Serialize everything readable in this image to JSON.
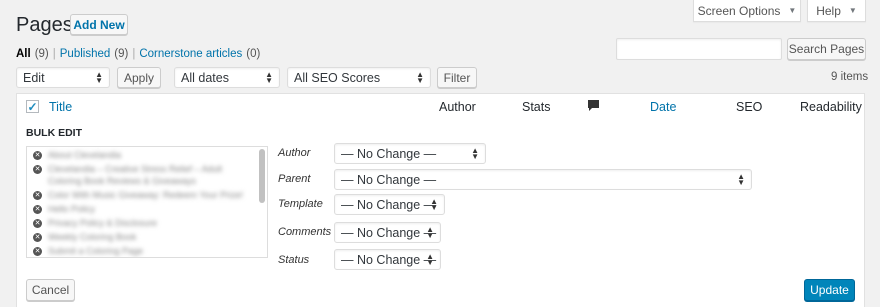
{
  "header": {
    "title": "Pages",
    "add_new": "Add New"
  },
  "screen_tabs": {
    "screen_options": "Screen Options",
    "help": "Help"
  },
  "filters": {
    "all": "All",
    "all_count": "(9)",
    "sep1": "|",
    "published": "Published",
    "published_count": "(9)",
    "sep2": "|",
    "cornerstone": "Cornerstone articles",
    "cornerstone_count": "(0)"
  },
  "search": {
    "placeholder": "",
    "button": "Search Pages"
  },
  "bulk_bar": {
    "action_value": "Edit",
    "apply": "Apply",
    "dates_value": "All dates",
    "seo_value": "All SEO Scores",
    "filter": "Filter",
    "items_count": "9 items"
  },
  "columns": {
    "title": "Title",
    "author": "Author",
    "stats": "Stats",
    "date": "Date",
    "seo": "SEO",
    "readability": "Readability"
  },
  "bulk_edit": {
    "heading": "BULK EDIT",
    "titles": [
      "About Clevelandia",
      "Clevelandia – Creative Stress Relief – Adult",
      "Coloring Book Reviews & Giveaways",
      "Color With Music Giveaway: Redeem Your Prize!",
      "Hello Policy",
      "Privacy Policy & Disclosure",
      "Weekly Coloring Book",
      "Submit a Coloring Page"
    ],
    "fields": {
      "author_label": "Author",
      "author_value": "— No Change —",
      "parent_label": "Parent",
      "parent_value": "— No Change —",
      "template_label": "Template",
      "template_value": "— No Change —",
      "comments_label": "Comments",
      "comments_value": "— No Change —",
      "status_label": "Status",
      "status_value": "— No Change —"
    },
    "cancel": "Cancel",
    "update": "Update"
  },
  "colors": {
    "link": "#0073aa",
    "primary": "#0085ba",
    "background": "#f1f1f1"
  }
}
